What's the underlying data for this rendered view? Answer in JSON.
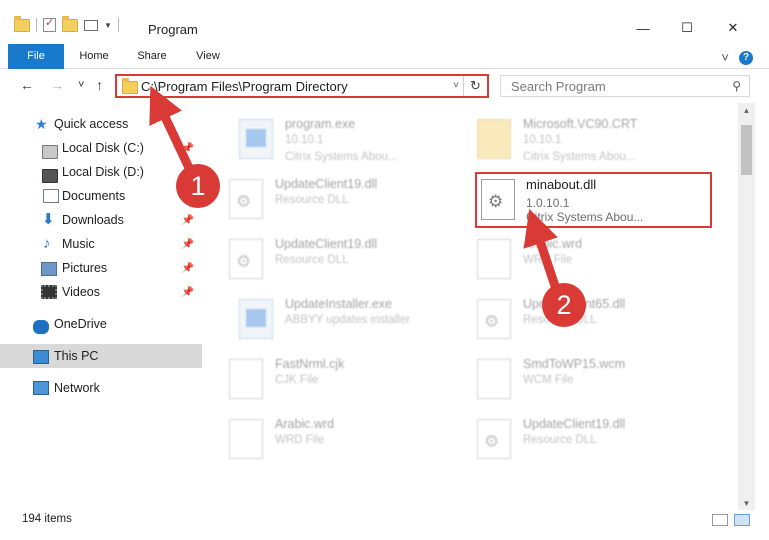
{
  "window": {
    "title": "Program",
    "minimize": "—",
    "maximize": "☐",
    "close": "✕"
  },
  "ribbon": {
    "tabs": [
      "File",
      "Home",
      "Share",
      "View"
    ],
    "collapse_glyph": "˅",
    "help_glyph": "?"
  },
  "nav": {
    "back_glyph": "←",
    "forward_glyph": "→",
    "recent_glyph": "˅",
    "up_glyph": "↑",
    "address": "C:\\Program Files\\Program Directory",
    "address_dropdown_glyph": "˅",
    "refresh_glyph": "↻",
    "search_placeholder": "Search Program",
    "search_glyph": "⚲"
  },
  "sidebar": {
    "items": [
      {
        "label": "Quick access",
        "icon": "star-icon",
        "pinned": false
      },
      {
        "label": "Local Disk (C:)",
        "icon": "drive-icon",
        "pinned": true
      },
      {
        "label": "Local Disk (D:)",
        "icon": "drive-icon",
        "pinned": false
      },
      {
        "label": "Documents",
        "icon": "documents-icon",
        "pinned": true
      },
      {
        "label": "Downloads",
        "icon": "download-icon",
        "pinned": true
      },
      {
        "label": "Music",
        "icon": "music-icon",
        "pinned": true
      },
      {
        "label": "Pictures",
        "icon": "pictures-icon",
        "pinned": true
      },
      {
        "label": "Videos",
        "icon": "videos-icon",
        "pinned": true
      },
      {
        "label": "OneDrive",
        "icon": "onedrive-icon",
        "pinned": false
      },
      {
        "label": "This PC",
        "icon": "this-pc-icon",
        "pinned": false,
        "selected": true
      },
      {
        "label": "Network",
        "icon": "network-icon",
        "pinned": false
      }
    ],
    "pin_glyph": "📌"
  },
  "files": [
    {
      "name": "program.exe",
      "line1": "10.10.1",
      "line2": "Citrix Systems Abou...",
      "icon": "exe-icon"
    },
    {
      "name": "Microsoft.VC90.CRT",
      "line1": "10.10.1",
      "line2": "Citrix Systems Abou...",
      "icon": "folder-icon"
    },
    {
      "name": "UpdateClient19.dll",
      "line1": "Resource DLL",
      "line2": "",
      "icon": "dll-icon"
    },
    {
      "name": "minabout.dll",
      "line1": "1.0.10.1",
      "line2": "Citrix Systems Abou...",
      "icon": "dll-icon",
      "highlighted": true
    },
    {
      "name": "UpdateClient19.dll",
      "line1": "Resource DLL",
      "line2": "",
      "icon": "dll-icon"
    },
    {
      "name": "Arabic.wrd",
      "line1": "WRD File",
      "line2": "",
      "icon": "blank-file-icon"
    },
    {
      "name": "UpdateInstaller.exe",
      "line1": "ABBYY updates installer",
      "line2": "",
      "icon": "installer-icon"
    },
    {
      "name": "UpdateClient65.dll",
      "line1": "Resource DLL",
      "line2": "",
      "icon": "dll-icon"
    },
    {
      "name": "FastNrml.cjk",
      "line1": "CJK File",
      "line2": "",
      "icon": "blank-file-icon"
    },
    {
      "name": "SmdToWP15.wcm",
      "line1": "WCM File",
      "line2": "",
      "icon": "blank-file-icon"
    },
    {
      "name": "Arabic.wrd",
      "line1": "WRD File",
      "line2": "",
      "icon": "blank-file-icon"
    },
    {
      "name": "UpdateClient19.dll",
      "line1": "Resource DLL",
      "line2": "",
      "icon": "dll-icon"
    }
  ],
  "status": {
    "item_count": "194 items"
  },
  "annotations": [
    {
      "label": "1",
      "target": "address-bar"
    },
    {
      "label": "2",
      "target": "minabout.dll"
    }
  ],
  "colors": {
    "accent": "#1979ca",
    "annotation": "#d93a36",
    "selected_bg": "#d9d9d9"
  }
}
